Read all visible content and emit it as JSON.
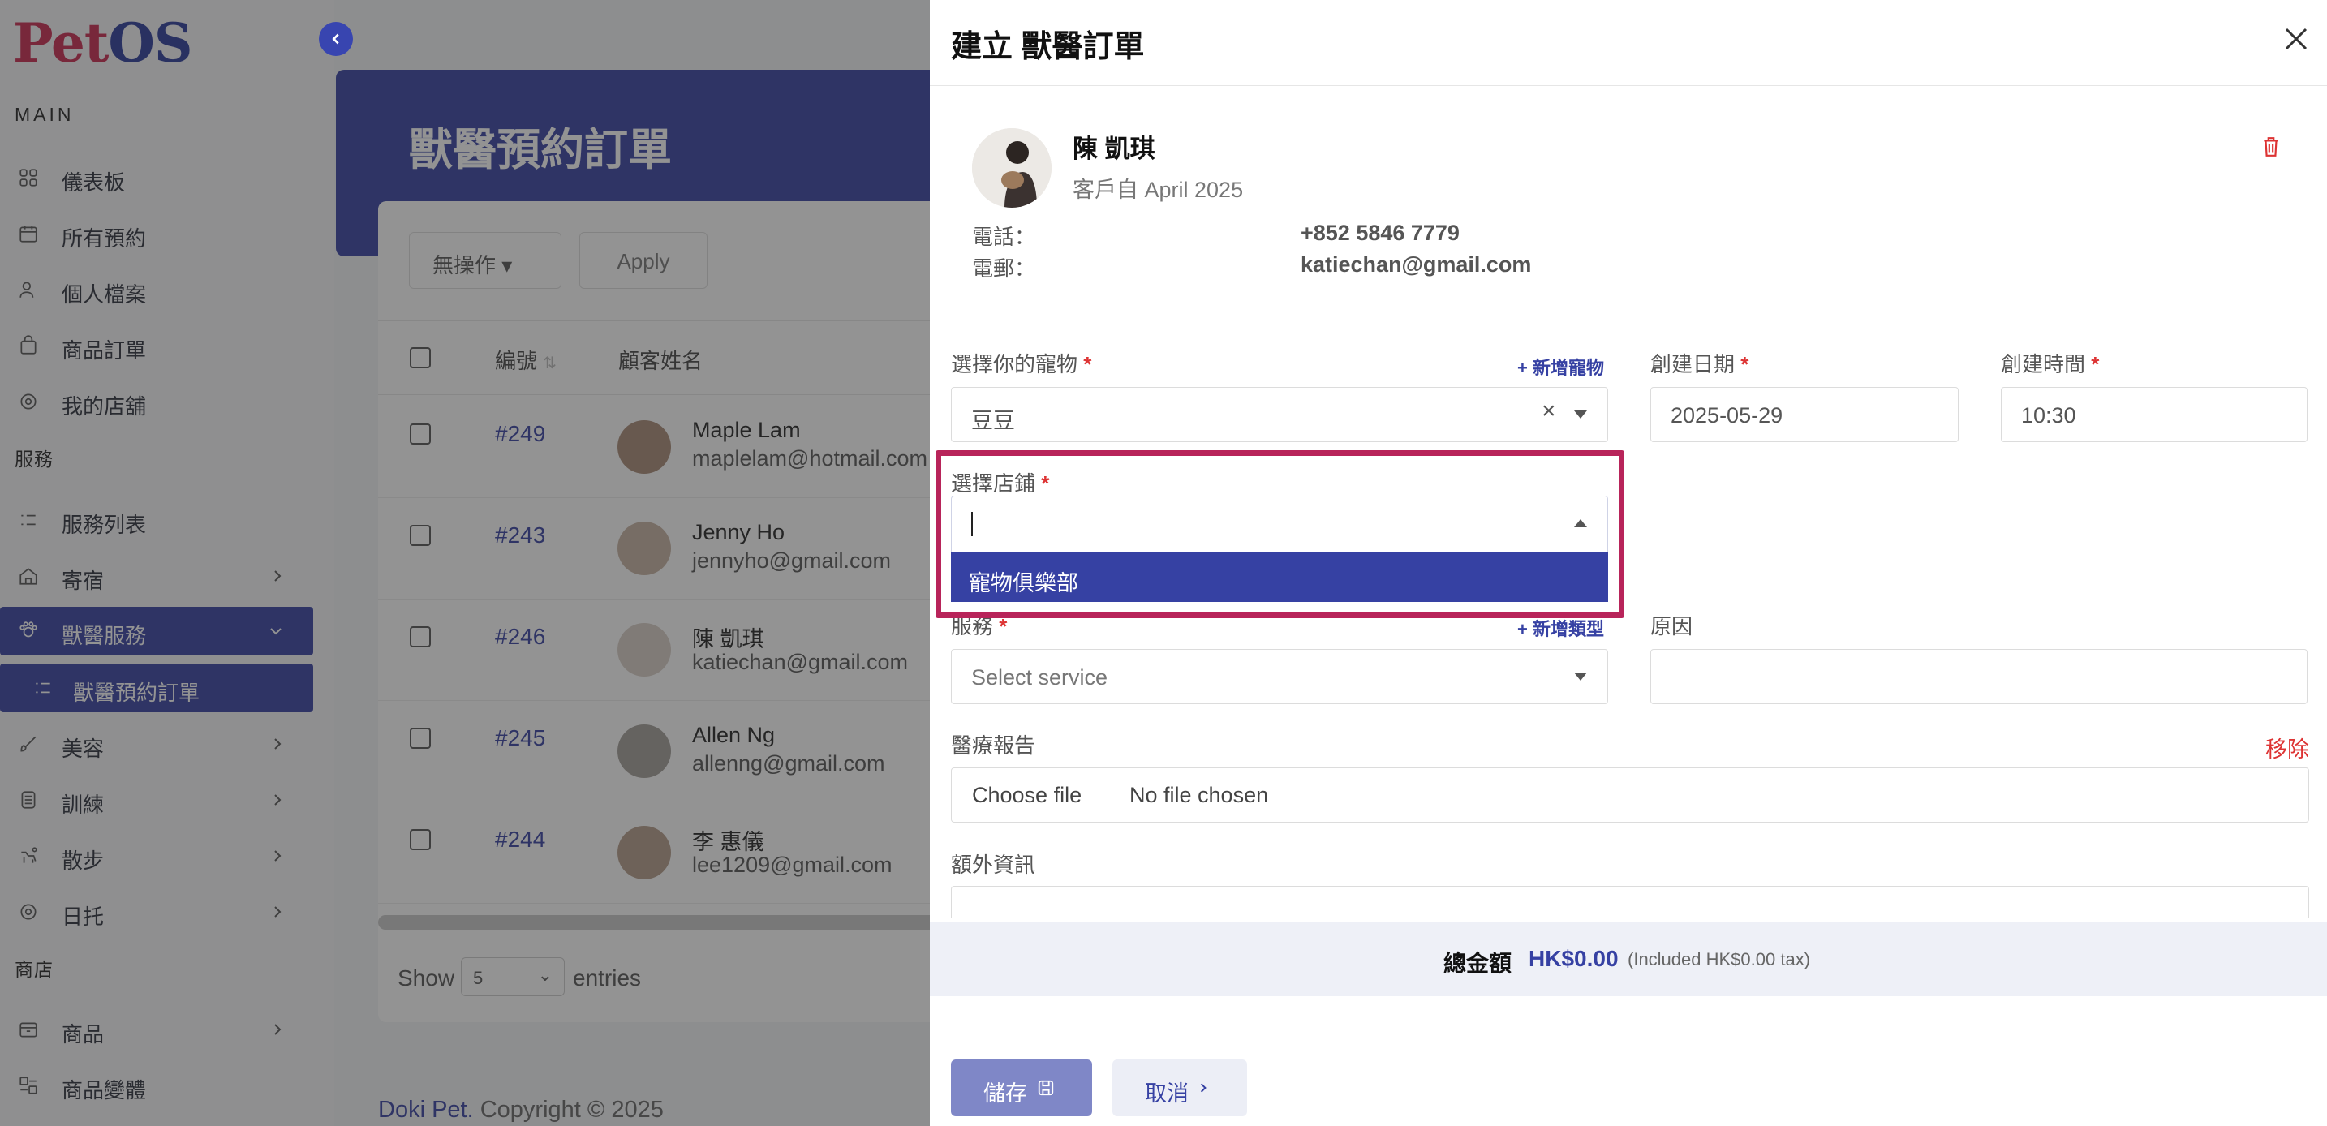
{
  "sidebar": {
    "logo": {
      "pet": "Pet",
      "os": "OS"
    },
    "sections": {
      "main": "MAIN",
      "services": "服務",
      "shop": "商店"
    },
    "items": [
      {
        "label": "儀表板",
        "icon": "grid-icon"
      },
      {
        "label": "所有預約",
        "icon": "calendar-icon"
      },
      {
        "label": "個人檔案",
        "icon": "user-icon"
      },
      {
        "label": "商品訂單",
        "icon": "bag-icon"
      },
      {
        "label": "我的店舖",
        "icon": "store-icon"
      },
      {
        "label": "服務列表",
        "icon": "list-icon"
      },
      {
        "label": "寄宿",
        "icon": "house-icon"
      },
      {
        "label": "獸醫服務",
        "icon": "vet-icon"
      },
      {
        "label": "獸醫預約訂單",
        "icon": "list-icon"
      },
      {
        "label": "美容",
        "icon": "brush-icon"
      },
      {
        "label": "訓練",
        "icon": "training-icon"
      },
      {
        "label": "散步",
        "icon": "walk-icon"
      },
      {
        "label": "日托",
        "icon": "daycare-icon"
      },
      {
        "label": "商品",
        "icon": "shop-icon"
      },
      {
        "label": "商品變體",
        "icon": "variant-icon"
      }
    ]
  },
  "main": {
    "page_title": "獸醫預約訂單",
    "bulk_action": "無操作",
    "apply": "Apply",
    "columns": {
      "id": "編號",
      "customer": "顧客姓名"
    },
    "rows": [
      {
        "id": "#249",
        "name": "Maple Lam",
        "email": "maplelam@hotmail.com"
      },
      {
        "id": "#243",
        "name": "Jenny Ho",
        "email": "jennyho@gmail.com"
      },
      {
        "id": "#246",
        "name": "陳 凱琪",
        "email": "katiechan@gmail.com"
      },
      {
        "id": "#245",
        "name": "Allen Ng",
        "email": "allenng@gmail.com"
      },
      {
        "id": "#244",
        "name": "李 惠儀",
        "email": "lee1209@gmail.com"
      }
    ],
    "show": "Show",
    "page_size": "5",
    "entries": "entries",
    "footer_brand": "Doki Pet.",
    "footer_text": " Copyright © 2025"
  },
  "drawer": {
    "title": "建立 獸醫訂單",
    "customer": {
      "name": "陳 凱琪",
      "since": "客戶自 April 2025",
      "phone_label": "電話：",
      "phone": "+852 5846 7779",
      "email_label": "電郵：",
      "email": "katiechan@gmail.com"
    },
    "pet": {
      "label": "選擇你的寵物",
      "add": "新增寵物",
      "value": "豆豆"
    },
    "date": {
      "label": "創建日期",
      "value": "2025-05-29"
    },
    "time": {
      "label": "創建時間",
      "value": "10:30"
    },
    "store": {
      "label": "選擇店鋪",
      "option": "寵物俱樂部"
    },
    "service": {
      "label": "服務",
      "add": "新增類型",
      "placeholder": "Select service"
    },
    "reason": {
      "label": "原因"
    },
    "report": {
      "label": "醫療報告",
      "remove": "移除",
      "choose": "Choose file",
      "none": "No file chosen"
    },
    "extra": {
      "label": "額外資訊"
    },
    "total": {
      "label": "總金額",
      "value": "HK$0.00",
      "tax": "(Included HK$0.00 tax)"
    },
    "save": "儲存",
    "cancel": "取消",
    "required_mark": "*"
  },
  "colors": {
    "primary": "#3641a3",
    "brand_red": "#c8294e",
    "focus_outline": "#b8245a",
    "danger": "#dd3333"
  }
}
